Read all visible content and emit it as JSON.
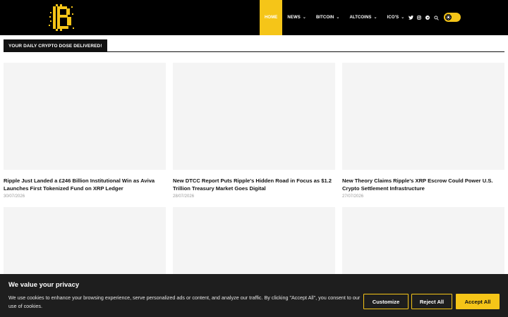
{
  "brand": {
    "logo_letter": "B",
    "accent": "#f5c518",
    "icon": "bitcoin-b-logo-icon"
  },
  "nav": {
    "items": [
      {
        "label": "HOME",
        "active": true,
        "dropdown": false
      },
      {
        "label": "NEWS",
        "active": false,
        "dropdown": true
      },
      {
        "label": "BITCOIN",
        "active": false,
        "dropdown": true
      },
      {
        "label": "ALTCOINS",
        "active": false,
        "dropdown": true
      },
      {
        "label": "ICO'S",
        "active": false,
        "dropdown": true
      }
    ],
    "icons": [
      "twitter-icon",
      "instagram-icon",
      "telegram-icon",
      "search-icon"
    ],
    "theme_toggle_icon": "sun-icon"
  },
  "section": {
    "heading": "YOUR DAILY CRYPTO DOSE DELIVERED!"
  },
  "posts": [
    {
      "title": "Ripple Just Landed a £246 Billion Institutional Win as Aviva Launches First Tokenized Fund on XRP Ledger",
      "date": "30/07/2026"
    },
    {
      "title": "New DTCC Report Puts Ripple's Hidden Road in Focus as $1.2 Trillion Treasury Market Goes Digital",
      "date": "28/07/2026"
    },
    {
      "title": "New Theory Claims Ripple's XRP Escrow Could Power U.S. Crypto Settlement Infrastructure",
      "date": "27/07/2026"
    },
    {
      "title": "",
      "date": ""
    },
    {
      "title": "",
      "date": ""
    },
    {
      "title": "",
      "date": ""
    }
  ],
  "cookie": {
    "title": "We value your privacy",
    "text": "We use cookies to enhance your browsing experience, serve personalized ads or content, and analyze our traffic. By clicking \"Accept All\", you consent to our use of cookies.",
    "customize_label": "Customize",
    "reject_label": "Reject All",
    "accept_label": "Accept All"
  }
}
